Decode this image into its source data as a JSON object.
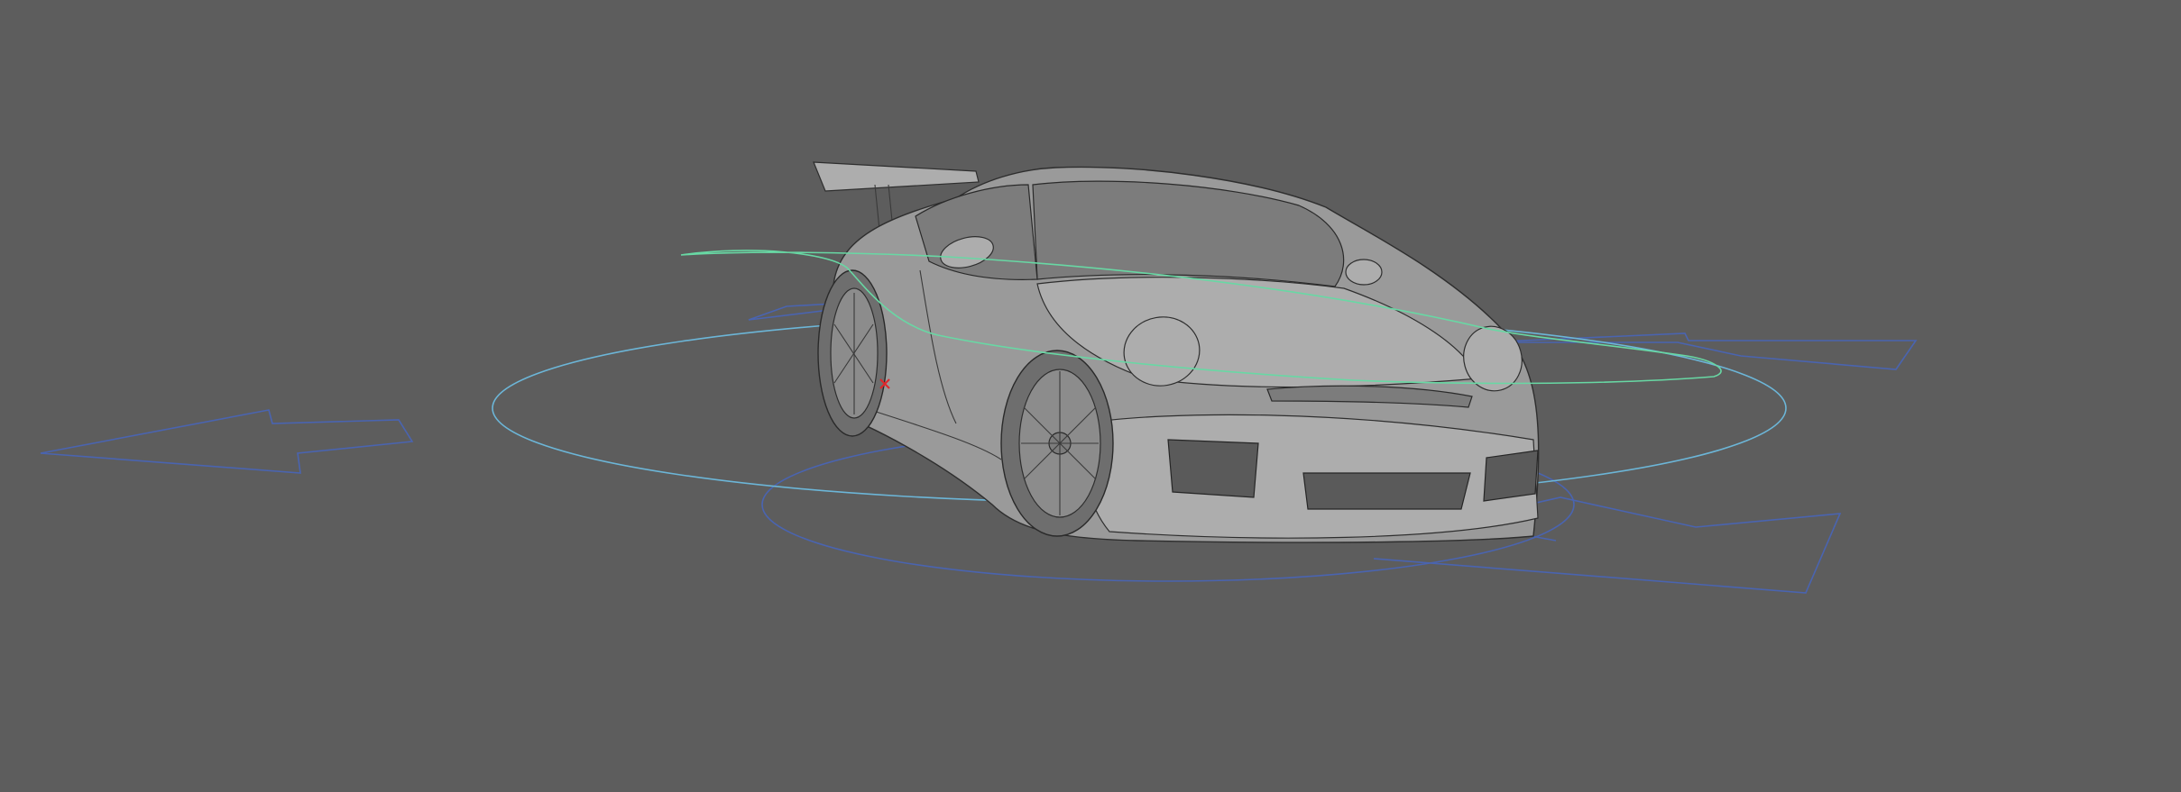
{
  "viewport": {
    "background_color": "#5d5d5d",
    "object": "car-model",
    "display_mode": "shaded-wireframe"
  },
  "rig": {
    "controls": [
      {
        "name": "outer-ground-control",
        "color": "#4a64b0"
      },
      {
        "name": "main-circle-control",
        "color": "#6cb6d8"
      },
      {
        "name": "body-control",
        "color": "#68d8a4"
      }
    ],
    "direction_arrows": [
      "left",
      "right-back",
      "right-front",
      "rear-left"
    ]
  },
  "pivot": {
    "icon": "pivot-x-icon",
    "color": "#e0262a"
  }
}
